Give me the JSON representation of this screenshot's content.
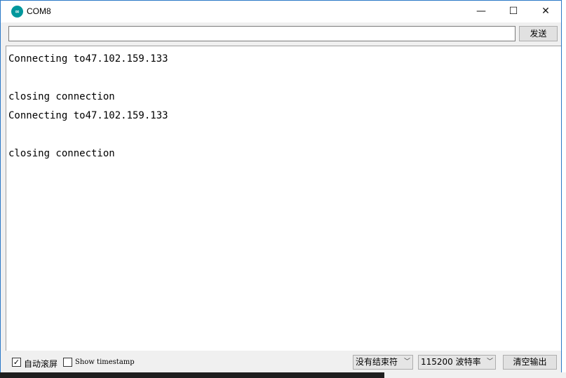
{
  "window": {
    "title": "COM8",
    "icon": "arduino-icon",
    "minimize_glyph": "—",
    "maximize_glyph": "☐",
    "close_glyph": "✕"
  },
  "input": {
    "value": "",
    "send_label": "发送"
  },
  "output": {
    "lines": [
      "Connecting to47.102.159.133",
      "",
      "closing connection",
      "Connecting to47.102.159.133",
      "",
      "closing connection"
    ]
  },
  "footer": {
    "autoscroll_label": "自动滚屏",
    "autoscroll_checked": true,
    "timestamp_label": "Show timestamp",
    "timestamp_checked": false,
    "line_ending": "没有结束符",
    "baud_rate": "115200 波特率",
    "clear_label": "清空输出"
  },
  "colors": {
    "title_accent": "#2b79c7",
    "icon_teal": "#00979c"
  }
}
